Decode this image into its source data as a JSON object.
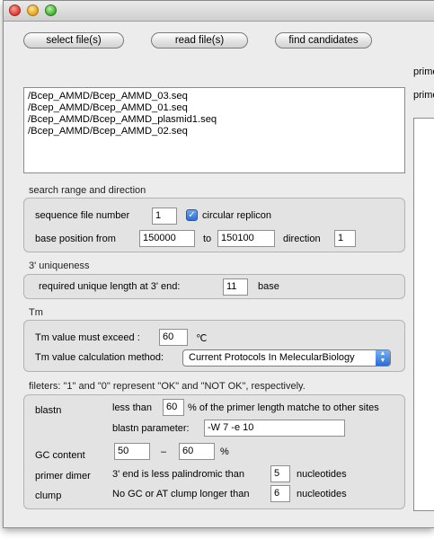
{
  "toolbar": {
    "select_label": "select file(s)",
    "read_label": "read file(s)",
    "find_label": "find candidates"
  },
  "files": [
    "/Bcep_AMMD/Bcep_AMMD_03.seq",
    "/Bcep_AMMD/Bcep_AMMD_01.seq",
    "/Bcep_AMMD/Bcep_AMMD_plasmid1.seq",
    "/Bcep_AMMD/Bcep_AMMD_02.seq"
  ],
  "right_panel": {
    "label1": "prime",
    "label2": "prime"
  },
  "search": {
    "title": "search range and direction",
    "seq_label": "sequence file number",
    "seq_value": "1",
    "circular_label": "circular replicon",
    "circular_checked": true,
    "base_from_label": "base position from",
    "from_value": "150000",
    "to_label": "to",
    "to_value": "150100",
    "direction_label": "direction",
    "direction_value": "1"
  },
  "uniq": {
    "title": "3' uniqueness",
    "req_label": "required unique length at 3' end:",
    "req_value": "11",
    "base_label": "base"
  },
  "tm": {
    "title": "Tm",
    "exceed_label": "Tm value must exceed :",
    "exceed_value": "60",
    "unit": "℃",
    "method_label": "Tm value calculation method:",
    "method_value": "Current Protocols In MelecularBiology"
  },
  "filters": {
    "title": "fileters: \"1\" and \"0\" represent \"OK\" and \"NOT OK\", respectively.",
    "blastn_label": "blastn",
    "less_than": "less than",
    "match_value": "60",
    "match_text": "% of the primer length matche to other sites",
    "blastn_param_label": "blastn parameter:",
    "blastn_param_value": "-W 7 -e 10",
    "gc_label": "GC content",
    "gc_min": "50",
    "dash": "–",
    "gc_max": "60",
    "percent": "%",
    "dimer_label": "primer dimer",
    "dimer_text": "3' end is less palindromic than",
    "dimer_value": "5",
    "nucleotides1": "nucleotides",
    "clump_label": "clump",
    "clump_text": "No GC or AT clump longer than",
    "clump_value": "6",
    "nucleotides2": "nucleotides"
  }
}
